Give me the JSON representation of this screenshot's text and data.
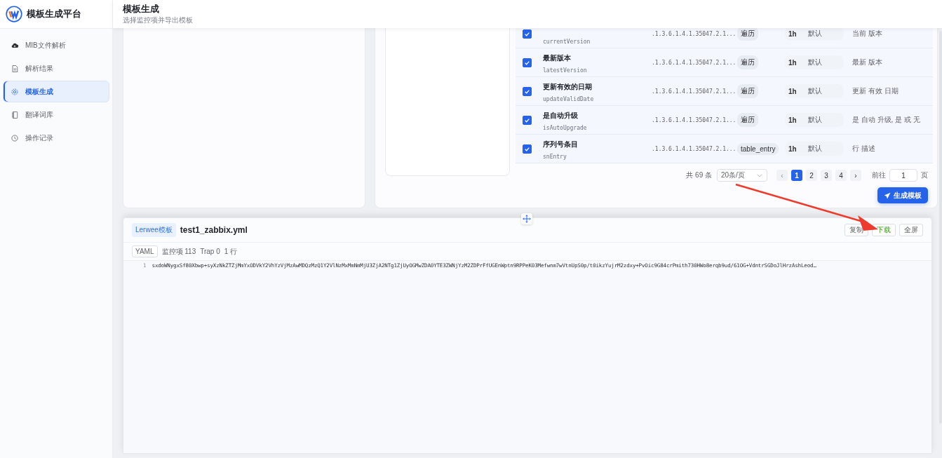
{
  "app": {
    "title": "模板生成平台"
  },
  "sidebar": {
    "items": [
      {
        "label": "MIB文件解析",
        "selected": false
      },
      {
        "label": "解析结果",
        "selected": false
      },
      {
        "label": "模板生成",
        "selected": true
      },
      {
        "label": "翻译词库",
        "selected": false
      },
      {
        "label": "操作记录",
        "selected": false
      }
    ]
  },
  "header": {
    "title": "模板生成",
    "subtitle": "选择监控项并导出模板"
  },
  "table": {
    "rows": [
      {
        "checked": true,
        "key": "currentVersion",
        "oid": ".1.3.6.1.4.1.35047.2.1....",
        "type": "遍历",
        "interval": "1h",
        "mode": "默认",
        "description": "当前 版本"
      },
      {
        "checked": true,
        "name": "最新版本",
        "key": "latestVersion",
        "oid": ".1.3.6.1.4.1.35047.2.1....",
        "type": "遍历",
        "interval": "1h",
        "mode": "默认",
        "description": "最新 版本"
      },
      {
        "checked": true,
        "name": "更新有效的日期",
        "key": "updateValidDate",
        "oid": ".1.3.6.1.4.1.35047.2.1....",
        "type": "遍历",
        "interval": "1h",
        "mode": "默认",
        "description": "更新 有效 日期"
      },
      {
        "checked": true,
        "name": "是自动升级",
        "key": "isAutoUpgrade",
        "oid": ".1.3.6.1.4.1.35047.2.1....",
        "type": "遍历",
        "interval": "1h",
        "mode": "默认",
        "description": "是 自动 升级, 是 或 无"
      },
      {
        "checked": true,
        "name": "序列号条目",
        "key": "snEntry",
        "oid": ".1.3.6.1.4.1.35047.2.1....",
        "type": "table_entry",
        "interval": "1h",
        "mode": "默认",
        "description": "行 描述"
      }
    ]
  },
  "pagination": {
    "total": "共 69 条",
    "page_size": "20条/页",
    "prev": "‹",
    "next": "›",
    "pages": [
      {
        "label": "1",
        "selected": true
      },
      {
        "label": "2",
        "selected": false
      },
      {
        "label": "3",
        "selected": false
      },
      {
        "label": "4",
        "selected": false
      }
    ],
    "goto_label": "前往",
    "goto_value": "1",
    "page_suffix": "页"
  },
  "generate_button": "生成模板",
  "output": {
    "tag": "Lerwee模板",
    "filename": "test1_zabbix.yml",
    "buttons": [
      {
        "label": "复制",
        "kind": "plain"
      },
      {
        "label": "下载",
        "kind": "success"
      },
      {
        "label": "全屏",
        "kind": "plain"
      }
    ],
    "format": "YAML",
    "stats": [
      "监控项 113",
      "Trap 0",
      "1 行"
    ],
    "lines": [
      {
        "number": "1",
        "text": "sxdoWNygxSf80Xbwp+syXzNkZTZjMmYxODVkY2VhYzVjMzAwMDQzMzQ1Y2VlNzMxMmNmMjU3ZjA2NTg1ZjUyOGMwZDA0YTE3ZWNjYzM2ZDPrFfUGEnWptn9RPPeK03Mefwnm7wVtnUpS0p/t0ikzYujrM2zdxy+PvOic9G84crPmith730HWo8erqb9ud/61OG+VdntrSGDoJlHrzAshLeod…"
      }
    ]
  }
}
